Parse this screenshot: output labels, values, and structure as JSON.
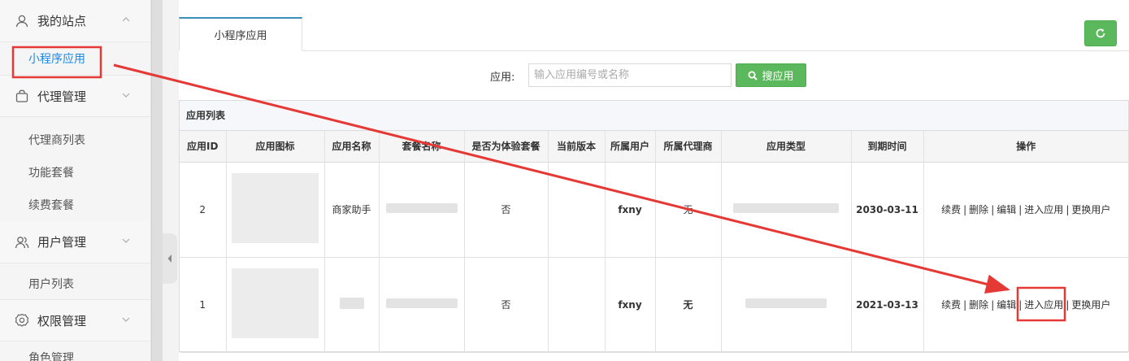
{
  "sidebar": {
    "groups": [
      {
        "label": "我的站点",
        "icon": "user-icon",
        "items": [
          "小程序应用"
        ]
      },
      {
        "label": "代理管理",
        "icon": "bag-icon",
        "items": [
          "代理商列表",
          "功能套餐",
          "续费套餐"
        ]
      },
      {
        "label": "用户管理",
        "icon": "users-icon",
        "items": [
          "用户列表"
        ]
      },
      {
        "label": "权限管理",
        "icon": "gear-icon",
        "items": [
          "角色管理"
        ]
      }
    ],
    "active_item": "小程序应用"
  },
  "tabs": [
    {
      "label": "小程序应用"
    }
  ],
  "search": {
    "label": "应用:",
    "placeholder": "输入应用编号或名称",
    "button_label": "搜应用"
  },
  "list": {
    "title": "应用列表",
    "columns": [
      "应用ID",
      "应用图标",
      "应用名称",
      "套餐名称",
      "是否为体验套餐",
      "当前版本",
      "所属用户",
      "所属代理商",
      "应用类型",
      "到期时间",
      "操作"
    ],
    "rows": [
      {
        "id": "2",
        "name": "商家助手",
        "trial": "否",
        "version": "",
        "user": "fxny",
        "agent": "无",
        "expire": "2030-03-11"
      },
      {
        "id": "1",
        "name": "",
        "trial": "否",
        "version": "",
        "user": "fxny",
        "agent": "无",
        "expire": "2021-03-13"
      }
    ],
    "actions": [
      "续费",
      "删除",
      "编辑",
      "进入应用",
      "更换用户"
    ]
  },
  "colors": {
    "accent_blue": "#1e88e5",
    "button_green": "#5cb85c",
    "annotation_red": "#e53935"
  }
}
